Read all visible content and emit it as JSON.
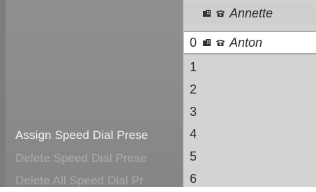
{
  "menu": {
    "items": [
      {
        "label": "Assign Speed Dial Prese",
        "state": "active"
      },
      {
        "label": "Delete Speed Dial Prese",
        "state": "dim"
      },
      {
        "label": "Delete All Speed Dial Pr",
        "state": "dim"
      }
    ]
  },
  "phonebook": {
    "header": {
      "name": "Annette",
      "icons": [
        "building-icon",
        "phone-icon"
      ]
    },
    "selected": {
      "number": "0",
      "name": "Anton",
      "icons": [
        "building-icon",
        "phone-icon"
      ]
    },
    "rows": [
      {
        "number": "1"
      },
      {
        "number": "2"
      },
      {
        "number": "3"
      },
      {
        "number": "4"
      },
      {
        "number": "5"
      },
      {
        "number": "6"
      }
    ]
  },
  "colors": {
    "panel_left": "#8a8a8a",
    "panel_right": "#d3d3d3",
    "selection": "#ffffff",
    "menu_active": "#f4f4f4",
    "menu_dim": "#aaaaaa"
  }
}
